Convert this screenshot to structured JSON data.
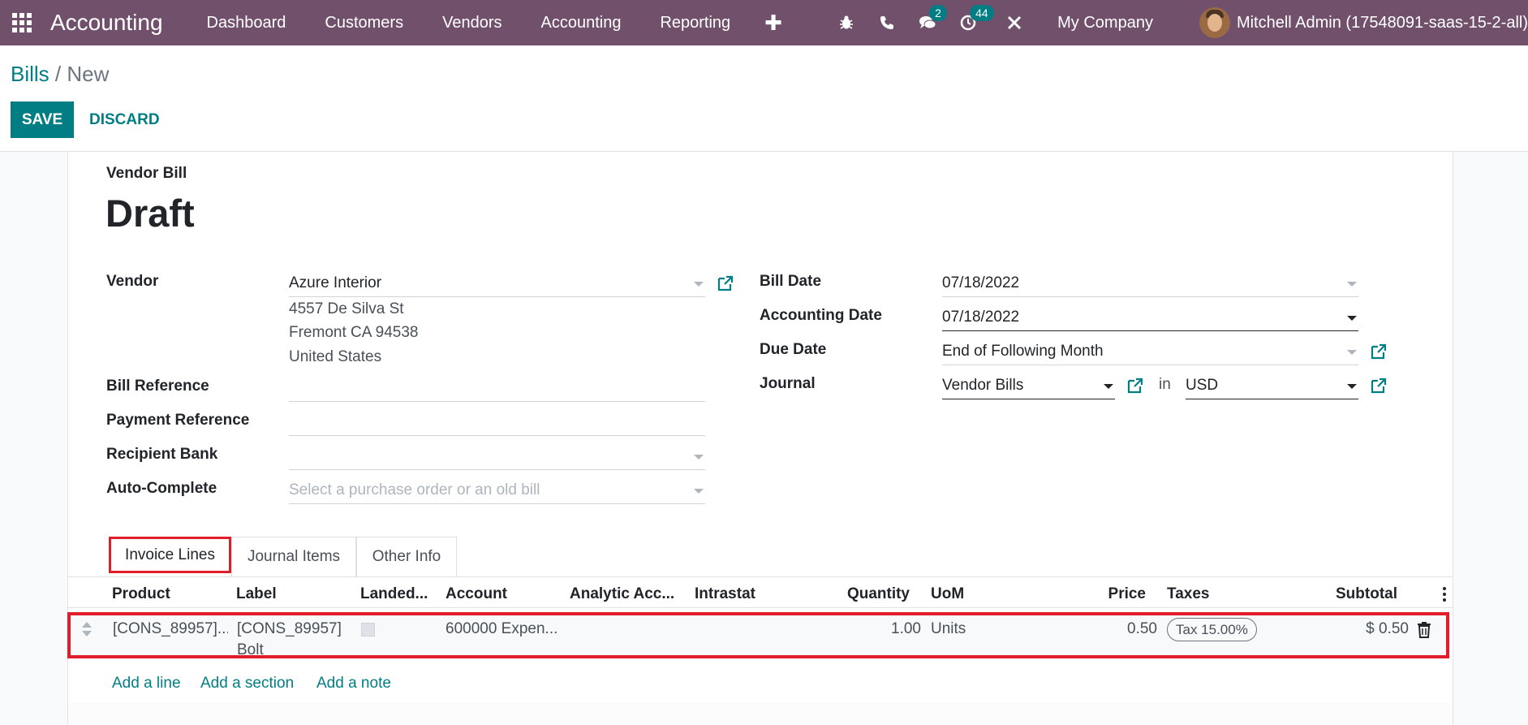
{
  "navbar": {
    "app_name": "Accounting",
    "menu": [
      "Dashboard",
      "Customers",
      "Vendors",
      "Accounting",
      "Reporting"
    ],
    "plus": "✚",
    "messages_count": "2",
    "activities_count": "44",
    "company": "My Company",
    "user": "Mitchell Admin (17548091-saas-15-2-all)",
    "color": "#71506b"
  },
  "breadcrumb": {
    "parent": "Bills",
    "separator": "/",
    "current": "New"
  },
  "buttons": {
    "save": "SAVE",
    "discard": "DISCARD"
  },
  "document": {
    "type": "Vendor Bill",
    "status": "Draft"
  },
  "left_fields": {
    "vendor_label": "Vendor",
    "vendor_value": "Azure Interior",
    "address": [
      "4557 De Silva St",
      "Fremont CA 94538",
      "United States"
    ],
    "bill_reference_label": "Bill Reference",
    "bill_reference_value": "",
    "payment_reference_label": "Payment Reference",
    "payment_reference_value": "",
    "recipient_bank_label": "Recipient Bank",
    "recipient_bank_value": "",
    "auto_complete_label": "Auto-Complete",
    "auto_complete_placeholder": "Select a purchase order or an old bill"
  },
  "right_fields": {
    "bill_date_label": "Bill Date",
    "bill_date_value": "07/18/2022",
    "accounting_date_label": "Accounting Date",
    "accounting_date_value": "07/18/2022",
    "due_date_label": "Due Date",
    "due_date_value": "End of Following Month",
    "journal_label": "Journal",
    "journal_value": "Vendor Bills",
    "in_text": "in",
    "currency_value": "USD"
  },
  "tabs": [
    "Invoice Lines",
    "Journal Items",
    "Other Info"
  ],
  "table": {
    "headers": {
      "product": "Product",
      "label": "Label",
      "landed": "Landed...",
      "account": "Account",
      "analytic": "Analytic Acc...",
      "intrastat": "Intrastat",
      "quantity": "Quantity",
      "uom": "UoM",
      "price": "Price",
      "taxes": "Taxes",
      "subtotal": "Subtotal"
    },
    "row": {
      "product": "[CONS_89957]...",
      "label_line1": "[CONS_89957]",
      "label_line2": "Bolt",
      "account": "600000 Expen...",
      "analytic": "",
      "intrastat": "",
      "quantity": "1.00",
      "uom": "Units",
      "price": "0.50",
      "tax": "Tax 15.00%",
      "subtotal": "$ 0.50"
    },
    "add_links": [
      "Add a line",
      "Add a section",
      "Add a note"
    ]
  },
  "colors": {
    "primary": "#017e84",
    "highlight": "#e11d2a"
  }
}
